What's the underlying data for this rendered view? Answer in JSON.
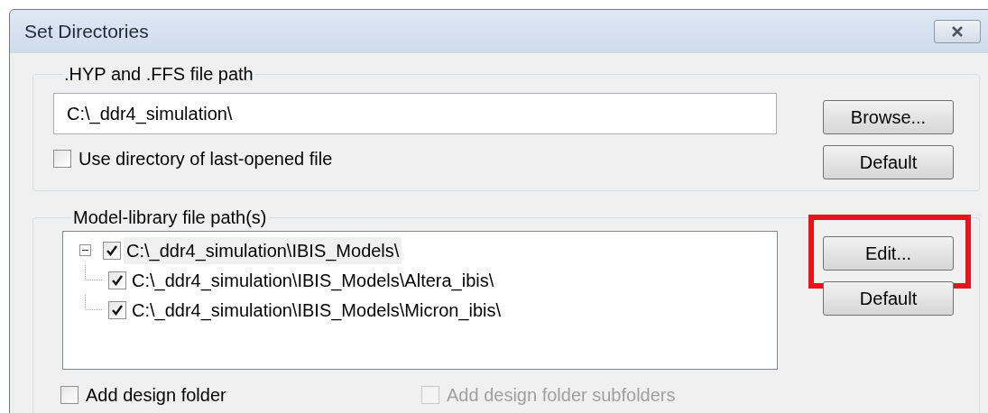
{
  "window": {
    "title": "Set Directories"
  },
  "hyp_group": {
    "legend": ".HYP and .FFS file path",
    "path": {
      "value": "C:\\_ddr4_simulation\\"
    },
    "use_last_dir": {
      "label": "Use directory of last-opened file",
      "checked": false
    },
    "buttons": [
      {
        "label": "Browse...",
        "highlighted": false
      },
      {
        "label": "Default",
        "highlighted": false
      }
    ]
  },
  "model_group": {
    "legend": "Model-library file path(s)",
    "tree": [
      {
        "label": "C:\\_ddr4_simulation\\IBIS_Models\\",
        "checked": true,
        "expanded": true,
        "selected": true,
        "children": [
          {
            "label": "C:\\_ddr4_simulation\\IBIS_Models\\Altera_ibis\\",
            "checked": true,
            "selected": false
          },
          {
            "label": "C:\\_ddr4_simulation\\IBIS_Models\\Micron_ibis\\",
            "checked": true,
            "selected": false
          }
        ]
      }
    ],
    "buttons": [
      {
        "label": "Edit...",
        "highlighted": true
      },
      {
        "label": "Default",
        "highlighted": false
      }
    ],
    "options": [
      {
        "label": "Add design folder",
        "checked": false,
        "disabled": false
      },
      {
        "label": "Add design folder subfolders",
        "checked": false,
        "disabled": true
      }
    ]
  }
}
